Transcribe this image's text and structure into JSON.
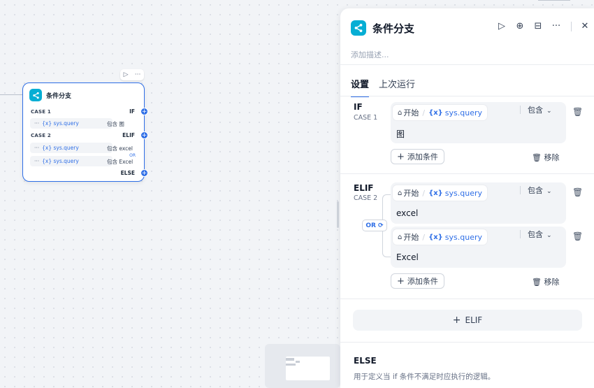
{
  "canvas": {
    "node": {
      "title": "条件分支",
      "toolbar": {
        "run_icon": "▷",
        "more_icon": "···"
      },
      "cases": [
        {
          "case_label": "CASE 1",
          "branch": "IF",
          "conditions": [
            {
              "dots": "···",
              "var": "{x} sys.query",
              "op": "包含",
              "value": "图"
            }
          ]
        },
        {
          "case_label": "CASE 2",
          "branch": "ELIF",
          "logic": "OR",
          "conditions": [
            {
              "dots": "···",
              "var": "{x} sys.query",
              "op": "包含",
              "value": "excel"
            },
            {
              "dots": "···",
              "var": "{x} sys.query",
              "op": "包含",
              "value": "Excel"
            }
          ]
        }
      ],
      "else_label": "ELSE",
      "handle_symbol": "+"
    }
  },
  "panel": {
    "title": "条件分支",
    "description_placeholder": "添加描述...",
    "header_icons": {
      "run": "▷",
      "locate": "⊕",
      "docs": "⊟",
      "more": "···",
      "close": "✕"
    },
    "tabs": [
      "设置",
      "上次运行"
    ],
    "branches": {
      "if": {
        "keyword": "IF",
        "case": "CASE 1",
        "condition": {
          "node": "开始",
          "var": "sys.query",
          "op": "包含",
          "value": "图"
        }
      },
      "elif": {
        "keyword": "ELIF",
        "case": "CASE 2",
        "logic": "OR",
        "conditions": [
          {
            "node": "开始",
            "var": "sys.query",
            "op": "包含",
            "value": "excel"
          },
          {
            "node": "开始",
            "var": "sys.query",
            "op": "包含",
            "value": "Excel"
          }
        ]
      }
    },
    "add_condition": "添加条件",
    "remove": "移除",
    "add_elif": "ELIF",
    "else": {
      "keyword": "ELSE",
      "description": "用于定义当 if 条件不满足时应执行的逻辑。"
    }
  },
  "colors": {
    "accent": "#2e6ee6",
    "node_icon": "#06aed4"
  }
}
